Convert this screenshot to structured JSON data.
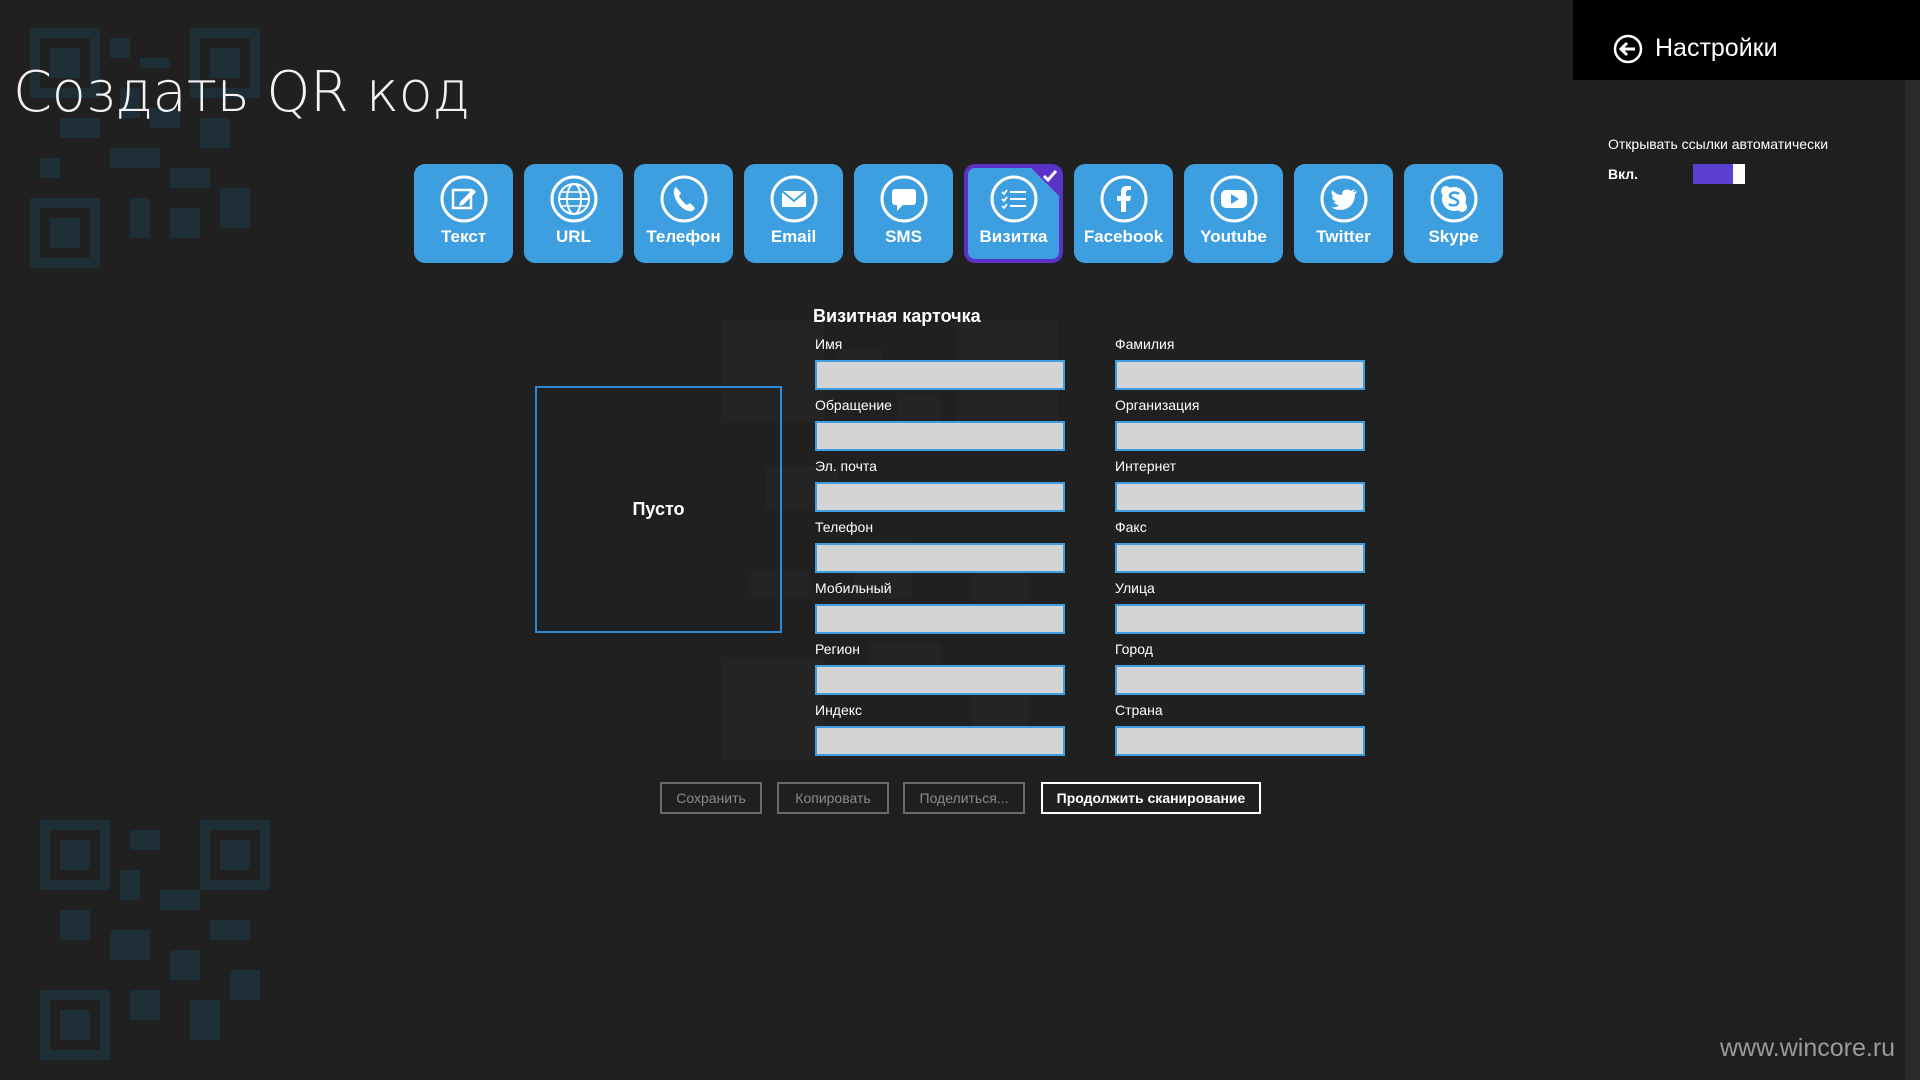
{
  "page": {
    "title": "Создать QR код"
  },
  "types": [
    {
      "id": "text",
      "label": "Текст",
      "icon": "pencil-square-icon"
    },
    {
      "id": "url",
      "label": "URL",
      "icon": "globe-icon"
    },
    {
      "id": "phone",
      "label": "Телефон",
      "icon": "phone-icon"
    },
    {
      "id": "email",
      "label": "Email",
      "icon": "envelope-icon"
    },
    {
      "id": "sms",
      "label": "SMS",
      "icon": "chat-bubble-icon"
    },
    {
      "id": "vcard",
      "label": "Визитка",
      "icon": "list-icon",
      "selected": true
    },
    {
      "id": "facebook",
      "label": "Facebook",
      "icon": "facebook-icon"
    },
    {
      "id": "youtube",
      "label": "Youtube",
      "icon": "youtube-icon"
    },
    {
      "id": "twitter",
      "label": "Twitter",
      "icon": "twitter-bird-icon"
    },
    {
      "id": "skype",
      "label": "Skype",
      "icon": "skype-icon"
    }
  ],
  "card": {
    "title": "Визитная карточка",
    "qr_placeholder": "Пусто",
    "fields": [
      {
        "label": "Имя",
        "value": ""
      },
      {
        "label": "Фамилия",
        "value": ""
      },
      {
        "label": "Обращение",
        "value": ""
      },
      {
        "label": "Организация",
        "value": ""
      },
      {
        "label": "Эл. почта",
        "value": ""
      },
      {
        "label": "Интернет",
        "value": ""
      },
      {
        "label": "Телефон",
        "value": ""
      },
      {
        "label": "Факс",
        "value": ""
      },
      {
        "label": "Мобильный",
        "value": ""
      },
      {
        "label": "Улица",
        "value": ""
      },
      {
        "label": "Регион",
        "value": ""
      },
      {
        "label": "Город",
        "value": ""
      },
      {
        "label": "Индекс",
        "value": ""
      },
      {
        "label": "Страна",
        "value": ""
      }
    ]
  },
  "actions": {
    "save": "Сохранить",
    "copy": "Копировать",
    "share": "Поделиться...",
    "continue": "Продолжить сканирование"
  },
  "settings": {
    "title": "Настройки",
    "auto_open_label": "Открывать ссылки автоматически",
    "toggle_state": "Вкл.",
    "toggle_on": true
  },
  "watermark": "www.wincore.ru",
  "colors": {
    "tile_blue": "#3d9fe0",
    "selected_purple": "#5a33c6",
    "background": "#202020",
    "field_fill": "#d4d4d4"
  }
}
